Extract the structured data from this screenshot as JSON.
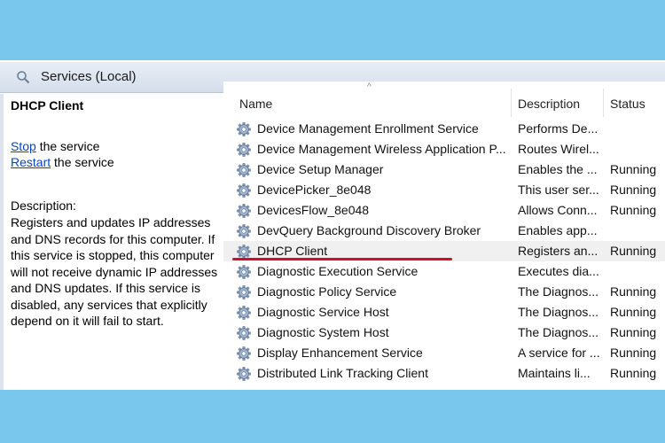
{
  "window": {
    "title": "Services (Local)"
  },
  "left_pane": {
    "service_name": "DHCP Client",
    "stop_link": "Stop",
    "stop_suffix": " the service",
    "restart_link": "Restart",
    "restart_suffix": " the service",
    "description_label": "Description:",
    "description_text": "Registers and updates IP addresses and DNS records for this computer. If this service is stopped, this computer will not receive dynamic IP addresses and DNS updates. If this service is disabled, any services that explicitly depend on it will fail to start."
  },
  "columns": {
    "name": "Name",
    "description": "Description",
    "status": "Status"
  },
  "rows": [
    {
      "name": "Device Management Enrollment Service",
      "description": "Performs De...",
      "status": ""
    },
    {
      "name": "Device Management Wireless Application P...",
      "description": "Routes Wirel...",
      "status": ""
    },
    {
      "name": "Device Setup Manager",
      "description": "Enables the ...",
      "status": "Running"
    },
    {
      "name": "DevicePicker_8e048",
      "description": "This user ser...",
      "status": "Running"
    },
    {
      "name": "DevicesFlow_8e048",
      "description": "Allows Conn...",
      "status": "Running"
    },
    {
      "name": "DevQuery Background Discovery Broker",
      "description": "Enables app...",
      "status": ""
    },
    {
      "name": "DHCP Client",
      "description": "Registers an...",
      "status": "Running"
    },
    {
      "name": "Diagnostic Execution Service",
      "description": "Executes dia...",
      "status": ""
    },
    {
      "name": "Diagnostic Policy Service",
      "description": "The Diagnos...",
      "status": "Running"
    },
    {
      "name": "Diagnostic Service Host",
      "description": "The Diagnos...",
      "status": "Running"
    },
    {
      "name": "Diagnostic System Host",
      "description": "The Diagnos...",
      "status": "Running"
    },
    {
      "name": "Display Enhancement Service",
      "description": "A service for ...",
      "status": "Running"
    },
    {
      "name": "Distributed Link Tracking Client",
      "description": "Maintains li...",
      "status": "Running"
    }
  ],
  "selected_index": 6,
  "colors": {
    "highlight": "#d0102a",
    "link": "#0645c8",
    "background": "#7ac7ee"
  }
}
